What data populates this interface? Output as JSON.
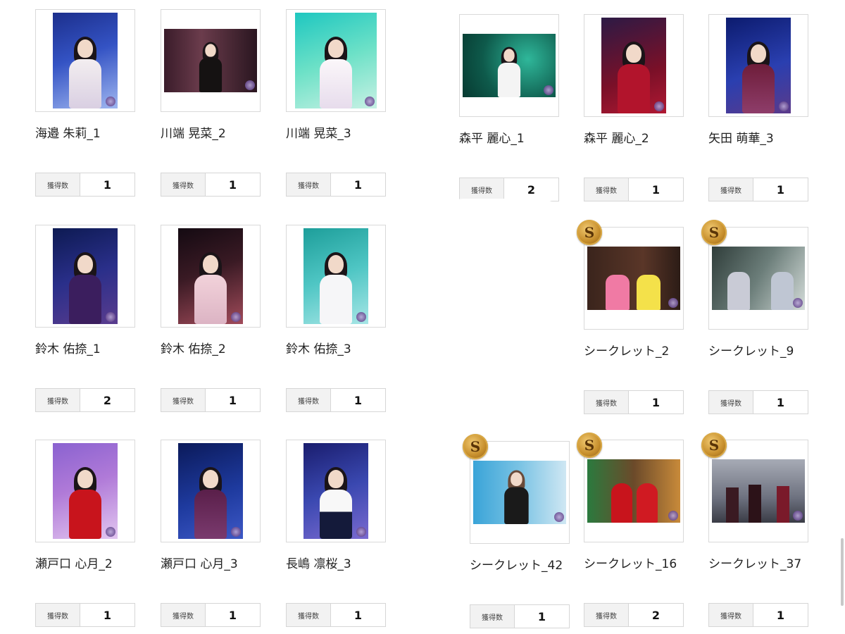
{
  "count_label": "獲得数",
  "secret_badge": "S",
  "cards": [
    {
      "label": "海邉 朱莉_1",
      "count": "1",
      "secret": false
    },
    {
      "label": "川端 晃菜_2",
      "count": "1",
      "secret": false
    },
    {
      "label": "川端 晃菜_3",
      "count": "1",
      "secret": false
    },
    {
      "label": "森平 麗心_1",
      "count": "2",
      "secret": false
    },
    {
      "label": "森平 麗心_2",
      "count": "1",
      "secret": false
    },
    {
      "label": "矢田 萌華_3",
      "count": "1",
      "secret": false
    },
    {
      "label": "鈴木 佑捺_1",
      "count": "2",
      "secret": false
    },
    {
      "label": "鈴木 佑捺_2",
      "count": "1",
      "secret": false
    },
    {
      "label": "鈴木 佑捺_3",
      "count": "1",
      "secret": false
    },
    {
      "label": "シークレット_2",
      "count": "1",
      "secret": true
    },
    {
      "label": "シークレット_9",
      "count": "1",
      "secret": true
    },
    {
      "label": "瀬戸口 心月_2",
      "count": "1",
      "secret": false
    },
    {
      "label": "瀬戸口 心月_3",
      "count": "1",
      "secret": false
    },
    {
      "label": "長嶋 凛桜_3",
      "count": "1",
      "secret": false
    },
    {
      "label": "シークレット_42",
      "count": "1",
      "secret": true
    },
    {
      "label": "シークレット_16",
      "count": "2",
      "secret": true
    },
    {
      "label": "シークレット_37",
      "count": "1",
      "secret": true
    }
  ]
}
